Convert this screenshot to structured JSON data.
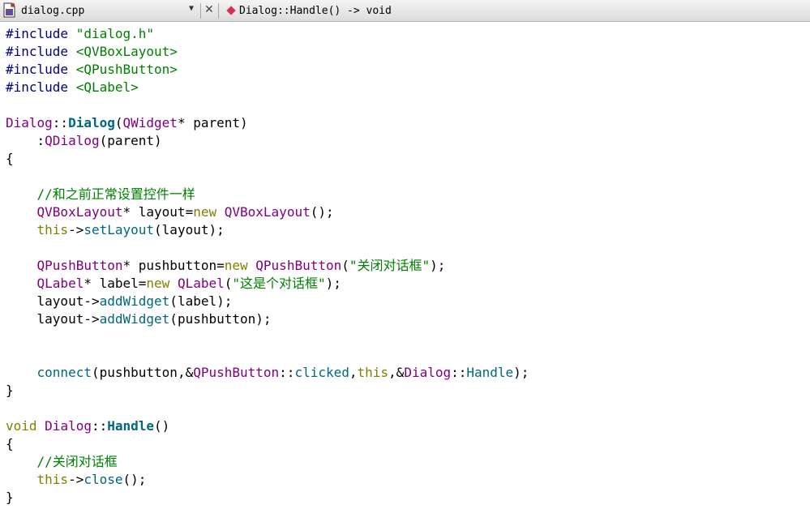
{
  "editor_toolbar": {
    "file_name": "dialog.cpp",
    "current_symbol": "Dialog::Handle() -> void",
    "close_glyph": "✕",
    "dropdown_glyph": "▼"
  },
  "colors": {
    "preprocessor": "#000080",
    "string": "#008000",
    "type": "#800080",
    "keyword": "#808000",
    "function": "#00677c",
    "comment": "#008000",
    "symbol_icon": "#d6304c"
  },
  "code_lines": [
    [
      [
        "preproc",
        "#include "
      ],
      [
        "string",
        "\"dialog.h\""
      ]
    ],
    [
      [
        "preproc",
        "#include "
      ],
      [
        "string",
        "<QVBoxLayout>"
      ]
    ],
    [
      [
        "preproc",
        "#include "
      ],
      [
        "string",
        "<QPushButton>"
      ]
    ],
    [
      [
        "preproc",
        "#include "
      ],
      [
        "string",
        "<QLabel>"
      ]
    ],
    [],
    [
      [
        "type",
        "Dialog"
      ],
      [
        "op",
        "::"
      ],
      [
        "funcdef",
        "Dialog"
      ],
      [
        "op",
        "("
      ],
      [
        "type",
        "QWidget"
      ],
      [
        "op",
        "* "
      ],
      [
        "plain",
        "parent"
      ],
      [
        "op",
        ")"
      ]
    ],
    [
      [
        "plain",
        "    :"
      ],
      [
        "type",
        "QDialog"
      ],
      [
        "op",
        "("
      ],
      [
        "plain",
        "parent"
      ],
      [
        "op",
        ")"
      ]
    ],
    [
      [
        "op",
        "{"
      ]
    ],
    [],
    [
      [
        "comment",
        "    //和之前正常设置控件一样"
      ]
    ],
    [
      [
        "plain",
        "    "
      ],
      [
        "type",
        "QVBoxLayout"
      ],
      [
        "op",
        "* "
      ],
      [
        "plain",
        "layout"
      ],
      [
        "op",
        "="
      ],
      [
        "keyword",
        "new"
      ],
      [
        "plain",
        " "
      ],
      [
        "type",
        "QVBoxLayout"
      ],
      [
        "op",
        "();"
      ]
    ],
    [
      [
        "plain",
        "    "
      ],
      [
        "keyword",
        "this"
      ],
      [
        "op",
        "->"
      ],
      [
        "func",
        "setLayout"
      ],
      [
        "op",
        "("
      ],
      [
        "plain",
        "layout"
      ],
      [
        "op",
        ");"
      ]
    ],
    [],
    [
      [
        "plain",
        "    "
      ],
      [
        "type",
        "QPushButton"
      ],
      [
        "op",
        "* "
      ],
      [
        "plain",
        "pushbutton"
      ],
      [
        "op",
        "="
      ],
      [
        "keyword",
        "new"
      ],
      [
        "plain",
        " "
      ],
      [
        "type",
        "QPushButton"
      ],
      [
        "op",
        "("
      ],
      [
        "string",
        "\"关闭对话框\""
      ],
      [
        "op",
        ");"
      ]
    ],
    [
      [
        "plain",
        "    "
      ],
      [
        "type",
        "QLabel"
      ],
      [
        "op",
        "* "
      ],
      [
        "plain",
        "label"
      ],
      [
        "op",
        "="
      ],
      [
        "keyword",
        "new"
      ],
      [
        "plain",
        " "
      ],
      [
        "type",
        "QLabel"
      ],
      [
        "op",
        "("
      ],
      [
        "string",
        "\"这是个对话框\""
      ],
      [
        "op",
        ");"
      ]
    ],
    [
      [
        "plain",
        "    layout"
      ],
      [
        "op",
        "->"
      ],
      [
        "func",
        "addWidget"
      ],
      [
        "op",
        "("
      ],
      [
        "plain",
        "label"
      ],
      [
        "op",
        ");"
      ]
    ],
    [
      [
        "plain",
        "    layout"
      ],
      [
        "op",
        "->"
      ],
      [
        "func",
        "addWidget"
      ],
      [
        "op",
        "("
      ],
      [
        "plain",
        "pushbutton"
      ],
      [
        "op",
        ");"
      ]
    ],
    [],
    [],
    [
      [
        "plain",
        "    "
      ],
      [
        "func",
        "connect"
      ],
      [
        "op",
        "("
      ],
      [
        "plain",
        "pushbutton"
      ],
      [
        "op",
        ",&"
      ],
      [
        "type",
        "QPushButton"
      ],
      [
        "op",
        "::"
      ],
      [
        "func",
        "clicked"
      ],
      [
        "op",
        ","
      ],
      [
        "keyword",
        "this"
      ],
      [
        "op",
        ",&"
      ],
      [
        "type",
        "Dialog"
      ],
      [
        "op",
        "::"
      ],
      [
        "func",
        "Handle"
      ],
      [
        "op",
        ");"
      ]
    ],
    [
      [
        "op",
        "}"
      ]
    ],
    [],
    [
      [
        "keyword",
        "void"
      ],
      [
        "plain",
        " "
      ],
      [
        "type",
        "Dialog"
      ],
      [
        "op",
        "::"
      ],
      [
        "funcdef",
        "Handle"
      ],
      [
        "op",
        "()"
      ]
    ],
    [
      [
        "op",
        "{"
      ]
    ],
    [
      [
        "comment",
        "    //关闭对话框"
      ]
    ],
    [
      [
        "plain",
        "    "
      ],
      [
        "keyword",
        "this"
      ],
      [
        "op",
        "->"
      ],
      [
        "func",
        "close"
      ],
      [
        "op",
        "();"
      ]
    ],
    [
      [
        "op",
        "}"
      ]
    ]
  ]
}
